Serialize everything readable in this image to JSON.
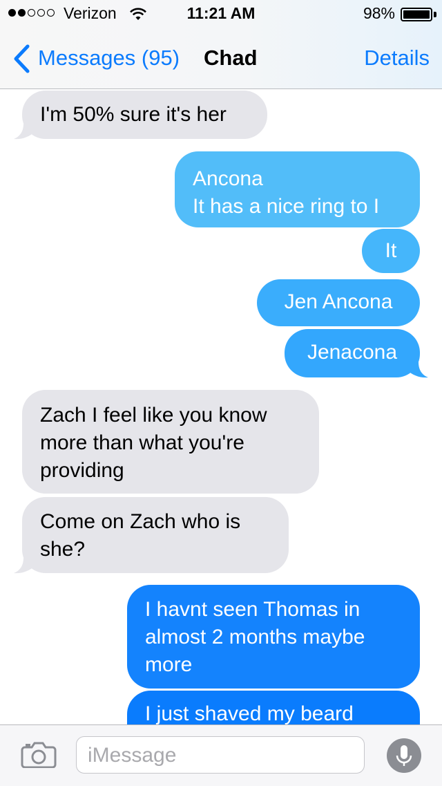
{
  "status_bar": {
    "carrier": "Verizon",
    "time": "11:21 AM",
    "battery": "98%",
    "signal_bars_filled": 2,
    "signal_bars_total": 5
  },
  "nav": {
    "back_label": "Messages (95)",
    "title": "Chad",
    "details_label": "Details"
  },
  "messages": [
    {
      "direction": "received",
      "text": "I'm 50% sure it's her"
    },
    {
      "direction": "sent",
      "text": "Ancona\nIt has a nice ring to I"
    },
    {
      "direction": "sent",
      "text": "It"
    },
    {
      "direction": "sent",
      "text": "Jen Ancona"
    },
    {
      "direction": "sent",
      "text": "Jenacona"
    },
    {
      "direction": "received",
      "text": "Zach I feel like you know\nmore than what you're\nproviding"
    },
    {
      "direction": "received",
      "text": "Come on Zach who is\nshe?"
    },
    {
      "direction": "sent",
      "text": "I havnt seen Thomas in\nalmost 2 months maybe\nmore"
    },
    {
      "direction": "sent",
      "text": "I just shaved my beard"
    }
  ],
  "input": {
    "placeholder": "iMessage"
  },
  "colors": {
    "accent": "#0b7bfd",
    "received_bubble": "#e5e5ea",
    "sent_bubble_top": "#52bdf9",
    "sent_bubble_bottom": "#0a7cfd"
  },
  "icons": {
    "back": "chevron-left-icon",
    "camera": "camera-icon",
    "mic": "microphone-icon",
    "wifi": "wifi-icon",
    "battery": "battery-icon"
  }
}
